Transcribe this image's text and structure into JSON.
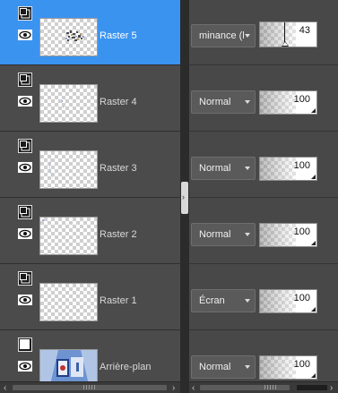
{
  "layers": [
    {
      "name": "Raster 5",
      "selected": true,
      "blend_mode": "minance (l",
      "opacity": "43",
      "opacity_fraction": 0.43,
      "thumb": "sparkles"
    },
    {
      "name": "Raster 4",
      "selected": false,
      "blend_mode": "Normal",
      "opacity": "100",
      "opacity_fraction": 1.0,
      "thumb": "empty"
    },
    {
      "name": "Raster 3",
      "selected": false,
      "blend_mode": "Normal",
      "opacity": "100",
      "opacity_fraction": 1.0,
      "thumb": "empty"
    },
    {
      "name": "Raster 2",
      "selected": false,
      "blend_mode": "Normal",
      "opacity": "100",
      "opacity_fraction": 1.0,
      "thumb": "empty"
    },
    {
      "name": "Raster 1",
      "selected": false,
      "blend_mode": "Écran",
      "opacity": "100",
      "opacity_fraction": 1.0,
      "thumb": "empty"
    },
    {
      "name": "Arrière-plan",
      "selected": false,
      "blend_mode": "Normal",
      "opacity": "100",
      "opacity_fraction": 1.0,
      "thumb": "image"
    }
  ],
  "colors": {
    "selected": "#3b93f0",
    "panel": "#4b4b4b",
    "right_panel": "#484848",
    "splitter": "#2b2b2b"
  },
  "icons": {
    "visibility": "layer-visibility-icon",
    "eye": "eye-icon",
    "scroll_left": "arrow-left-icon",
    "scroll_right": "arrow-right-icon",
    "splitter": "chevron-right-icon"
  }
}
